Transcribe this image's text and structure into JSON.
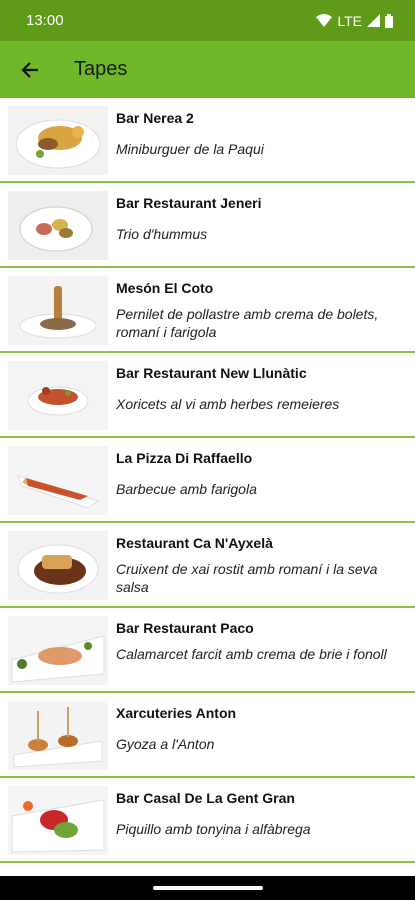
{
  "status": {
    "time": "13:00",
    "network": "LTE"
  },
  "app_bar": {
    "title": "Tapes",
    "back_icon": "arrow-left-icon"
  },
  "items": [
    {
      "name": "Bar Nerea 2",
      "desc": "Miniburguer de la Paqui"
    },
    {
      "name": "Bar Restaurant Jeneri",
      "desc": "Trio d'hummus"
    },
    {
      "name": "Mesón El Coto",
      "desc": "Pernilet de pollastre amb crema de bolets, romaní i farigola"
    },
    {
      "name": "Bar Restaurant New Llunàtic",
      "desc": "Xoricets al vi amb herbes remeieres"
    },
    {
      "name": "La Pizza Di Raffaello",
      "desc": "Barbecue amb farigola"
    },
    {
      "name": "Restaurant Ca N'Ayxelà",
      "desc": "Cruixent de xai rostit amb romaní i la seva salsa"
    },
    {
      "name": "Bar Restaurant Paco",
      "desc": "Calamarcet farcit amb crema de brie i fonoll"
    },
    {
      "name": "Xarcuteries Anton",
      "desc": "Gyoza a l'Anton"
    },
    {
      "name": "Bar Casal De La Gent Gran",
      "desc": "Piquillo amb tonyina i alfàbrega"
    }
  ],
  "colors": {
    "status_bar": "#5e9b18",
    "app_bar": "#70b72a",
    "divider": "#8bc34a"
  }
}
